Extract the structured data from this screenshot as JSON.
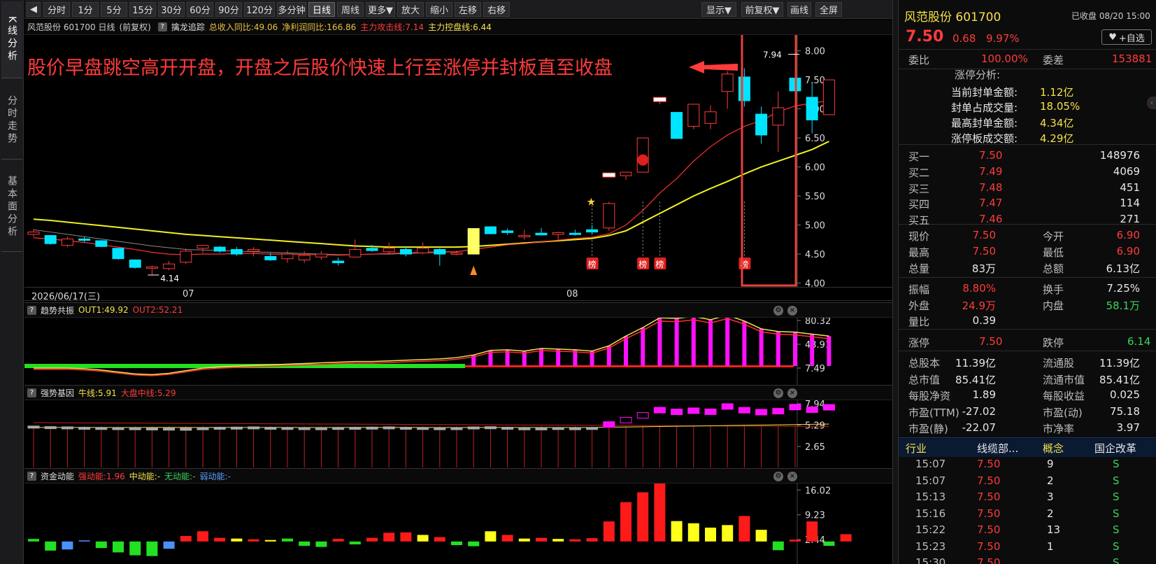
{
  "sidebar": {
    "tabs": [
      {
        "label": "K线分析",
        "active": true
      },
      {
        "label": "分时走势",
        "active": false
      },
      {
        "label": "基本面分析",
        "active": false
      }
    ]
  },
  "toolbar": {
    "back_icon": "collapse-left-icon",
    "buttons": [
      "分时",
      "1分",
      "5分",
      "15分",
      "30分",
      "60分",
      "90分",
      "120分",
      "多分钟",
      "日线",
      "周线",
      "更多▼",
      "放大",
      "缩小",
      "左移",
      "右移"
    ],
    "active": "日线",
    "right_buttons": [
      "显示▼",
      "前复权▼",
      "画线",
      "全屏"
    ]
  },
  "kline": {
    "info": {
      "title": "风范股份 601700 日线",
      "adjust": "(前复权)",
      "help": "?",
      "indicator": "擒龙追踪",
      "f1": "总收入同比:49.06",
      "f2": "净利润同比:166.86",
      "f3": "主力攻击线:7.14",
      "f4": "主力控盘线:6.44"
    },
    "annotation": "股价早盘跳空高开开盘，开盘之后股价快速上行至涨停并封板直至收盘",
    "y_ticks": [
      "8.00",
      "7.50",
      "7.00",
      "6.50",
      "6.00",
      "5.50",
      "5.00",
      "4.50",
      "4.00"
    ],
    "date_label": "2026/06/17(三)",
    "month_labels": [
      "07",
      "08"
    ],
    "high_label": "7.94",
    "low_label": "4.14",
    "bang_label": "榜",
    "colors": {
      "up": "#ff3b3b",
      "down": "#00e5ff",
      "ma_attack": "#ff3030",
      "ma_control": "#f0f020",
      "ma_gray": "#8a8a8a"
    },
    "candles": [
      [
        4.84,
        4.93,
        4.8,
        4.88
      ],
      [
        4.82,
        4.83,
        4.66,
        4.68
      ],
      [
        4.65,
        4.8,
        4.62,
        4.76
      ],
      [
        4.76,
        4.8,
        4.7,
        4.74
      ],
      [
        4.73,
        4.74,
        4.62,
        4.63
      ],
      [
        4.6,
        4.61,
        4.4,
        4.42
      ],
      [
        4.4,
        4.41,
        4.25,
        4.27
      ],
      [
        4.26,
        4.3,
        4.14,
        4.28
      ],
      [
        4.25,
        4.38,
        4.22,
        4.33
      ],
      [
        4.36,
        4.6,
        4.33,
        4.55
      ],
      [
        4.6,
        4.66,
        4.52,
        4.65
      ],
      [
        4.62,
        4.64,
        4.52,
        4.55
      ],
      [
        4.58,
        4.62,
        4.47,
        4.5
      ],
      [
        4.55,
        4.62,
        4.46,
        4.58
      ],
      [
        4.46,
        4.52,
        4.38,
        4.4
      ],
      [
        4.42,
        4.56,
        4.35,
        4.5
      ],
      [
        4.4,
        4.55,
        4.35,
        4.48
      ],
      [
        4.45,
        4.55,
        4.4,
        4.5
      ],
      [
        4.38,
        4.44,
        4.3,
        4.35
      ],
      [
        4.45,
        4.75,
        4.44,
        4.58
      ],
      [
        4.6,
        4.66,
        4.54,
        4.56
      ],
      [
        4.54,
        4.7,
        4.5,
        4.6
      ],
      [
        4.58,
        4.64,
        4.46,
        4.5
      ],
      [
        4.52,
        4.7,
        4.5,
        4.6
      ],
      [
        4.58,
        4.6,
        4.3,
        4.5
      ],
      [
        4.5,
        4.56,
        4.48,
        4.52
      ],
      [
        4.5,
        4.94,
        4.5,
        4.94
      ],
      [
        4.97,
        4.98,
        4.84,
        4.85
      ],
      [
        4.9,
        4.94,
        4.83,
        4.87
      ],
      [
        4.8,
        4.92,
        4.75,
        4.82
      ],
      [
        4.86,
        4.95,
        4.82,
        4.83
      ],
      [
        4.84,
        4.89,
        4.75,
        4.87
      ],
      [
        4.86,
        4.92,
        4.82,
        4.85
      ],
      [
        4.92,
        5.0,
        4.84,
        4.88
      ],
      [
        4.95,
        5.4,
        4.9,
        5.37
      ],
      [
        5.85,
        5.91,
        5.78,
        5.91
      ],
      [
        5.91,
        6.5,
        5.91,
        6.5
      ],
      [
        7.15,
        7.16,
        7.08,
        7.15
      ],
      [
        6.94,
        6.94,
        6.54,
        6.49
      ],
      [
        6.7,
        7.08,
        6.65,
        7.08
      ],
      [
        6.75,
        7.06,
        6.65,
        6.95
      ],
      [
        7.3,
        7.65,
        7.0,
        7.6
      ],
      [
        7.55,
        7.7,
        7.04,
        7.14
      ],
      [
        6.91,
        7.04,
        6.4,
        6.55
      ],
      [
        6.72,
        7.3,
        6.26,
        7.02
      ],
      [
        7.53,
        7.94,
        7.25,
        7.31
      ],
      [
        7.2,
        7.44,
        6.58,
        6.81
      ],
      [
        6.9,
        7.5,
        6.9,
        7.5
      ]
    ],
    "ma_attack": [
      4.78,
      4.76,
      4.73,
      4.7,
      4.66,
      4.62,
      4.58,
      4.53,
      4.5,
      4.49,
      4.5,
      4.5,
      4.51,
      4.51,
      4.5,
      4.5,
      4.49,
      4.49,
      4.48,
      4.49,
      4.5,
      4.51,
      4.52,
      4.53,
      4.54,
      4.54,
      4.58,
      4.62,
      4.66,
      4.68,
      4.71,
      4.74,
      4.77,
      4.79,
      4.85,
      5.0,
      5.25,
      5.55,
      5.8,
      6.1,
      6.35,
      6.55,
      6.7,
      6.8,
      6.95,
      7.05,
      7.1,
      7.14
    ],
    "ma_control": [
      5.1,
      5.08,
      5.05,
      5.02,
      4.99,
      4.96,
      4.93,
      4.9,
      4.87,
      4.84,
      4.82,
      4.8,
      4.78,
      4.76,
      4.74,
      4.72,
      4.7,
      4.68,
      4.66,
      4.64,
      4.63,
      4.62,
      4.62,
      4.62,
      4.62,
      4.62,
      4.63,
      4.65,
      4.67,
      4.69,
      4.71,
      4.73,
      4.75,
      4.77,
      4.82,
      4.9,
      5.05,
      5.2,
      5.35,
      5.5,
      5.63,
      5.75,
      5.88,
      6.0,
      6.1,
      6.2,
      6.3,
      6.44
    ],
    "ma_gray": [
      4.92,
      4.88,
      4.84,
      4.8,
      4.76,
      4.72,
      4.68,
      4.64,
      4.61,
      4.58,
      4.57,
      4.56,
      4.55,
      4.54,
      4.53,
      4.52,
      4.51,
      4.5,
      4.49,
      4.49,
      4.5,
      4.5,
      4.51,
      4.52,
      4.53,
      4.54,
      4.58,
      4.62,
      4.66,
      4.7
    ]
  },
  "trend": {
    "help": "?",
    "name": "趋势共振",
    "out1": "OUT1:49.92",
    "out2": "OUT2:52.21",
    "y_ticks": [
      "80.32",
      "43.91",
      "7.49"
    ],
    "values": [
      0,
      0,
      0,
      -1,
      -3,
      -6,
      -9,
      -10,
      -8,
      -4,
      0,
      2,
      3,
      4,
      5,
      6,
      7,
      8,
      9,
      10,
      10,
      11,
      12,
      13,
      14,
      16,
      20,
      27,
      28,
      26,
      30,
      29,
      28,
      26,
      34,
      49,
      62,
      77,
      76,
      79,
      74,
      81,
      72,
      60,
      56,
      55,
      52,
      49
    ],
    "bars_from": 26
  },
  "gene": {
    "help": "?",
    "name": "强势基因",
    "niu": "牛线:5.91",
    "dapan": "大盘中线:5.29",
    "y_ticks": [
      "7.94",
      "5.29",
      "2.65"
    ],
    "marks": [
      5.05,
      4.98,
      4.95,
      4.9,
      4.88,
      4.86,
      4.85,
      4.82,
      4.8,
      4.78,
      4.85,
      4.9,
      4.92,
      4.95,
      4.9,
      4.88,
      4.86,
      4.85,
      4.88,
      4.9,
      4.92,
      4.95,
      4.9,
      4.88,
      4.85,
      4.86,
      4.94,
      4.97,
      4.9,
      4.84,
      4.83,
      4.87,
      4.85,
      4.88,
      5.37,
      5.91,
      6.5,
      7.15,
      6.94,
      7.08,
      6.95,
      7.6,
      7.14,
      6.9,
      7.02,
      7.53,
      7.2,
      7.5
    ]
  },
  "money": {
    "help": "?",
    "name": "资金动能",
    "strong": "强动能:1.96",
    "mid": "中动能:-",
    "none": "无动能:-",
    "weak": "弱动能:-",
    "y_ticks": [
      "16.02",
      "9.23",
      "2.44"
    ],
    "bars": [
      [
        0.7,
        "g"
      ],
      [
        -2.5,
        "g"
      ],
      [
        -2.2,
        "b"
      ],
      [
        0.3,
        "b"
      ],
      [
        -1.8,
        "g"
      ],
      [
        -3.0,
        "g"
      ],
      [
        -3.8,
        "g"
      ],
      [
        -4.0,
        "g"
      ],
      [
        -2.0,
        "b"
      ],
      [
        1.5,
        "r"
      ],
      [
        2.8,
        "r"
      ],
      [
        1.0,
        "r"
      ],
      [
        0.8,
        "y"
      ],
      [
        0.6,
        "r"
      ],
      [
        0.4,
        "y"
      ],
      [
        0.8,
        "g"
      ],
      [
        -1.2,
        "g"
      ],
      [
        -1.5,
        "g"
      ],
      [
        0.7,
        "r"
      ],
      [
        -0.8,
        "g"
      ],
      [
        1.0,
        "r"
      ],
      [
        2.4,
        "r"
      ],
      [
        2.5,
        "r"
      ],
      [
        1.8,
        "y"
      ],
      [
        1.2,
        "r"
      ],
      [
        -1.0,
        "g"
      ],
      [
        -1.3,
        "g"
      ],
      [
        2.8,
        "y"
      ],
      [
        1.8,
        "r"
      ],
      [
        0.8,
        "y"
      ],
      [
        1.0,
        "r"
      ],
      [
        0.7,
        "y"
      ],
      [
        0.6,
        "r"
      ],
      [
        0.9,
        "r"
      ],
      [
        5.5,
        "r"
      ],
      [
        10.8,
        "r"
      ],
      [
        13.5,
        "r"
      ],
      [
        16.3,
        "r"
      ],
      [
        5.6,
        "y"
      ],
      [
        5.0,
        "y"
      ],
      [
        3.8,
        "y"
      ],
      [
        4.5,
        "y"
      ],
      [
        7.0,
        "r"
      ],
      [
        3.2,
        "y"
      ],
      [
        -2.4,
        "g"
      ],
      [
        0.5,
        "r"
      ],
      [
        5.5,
        "r"
      ],
      [
        -1.2,
        "g"
      ],
      [
        2.0,
        "r"
      ]
    ]
  },
  "stock": {
    "name": "风范股份",
    "code": "601700",
    "status": "已收盘 08/20 15:00",
    "price": "7.50",
    "change": "0.68",
    "pct": "9.97%",
    "add_label": "+自选",
    "weibi_label": "委比",
    "weibi": "100.00%",
    "weicha_label": "委差",
    "weicha": "153881",
    "zt_title": "涨停分析:",
    "zt": [
      {
        "k": "当前封单金额:",
        "v": "1.12亿"
      },
      {
        "k": "封单占成交量:",
        "v": "18.05%"
      },
      {
        "k": "最高封单金额:",
        "v": "4.34亿"
      },
      {
        "k": "涨停板成交额:",
        "v": "4.29亿"
      }
    ],
    "bids": [
      {
        "k": "买一",
        "p": "7.50",
        "v": "148976"
      },
      {
        "k": "买二",
        "p": "7.49",
        "v": "4069"
      },
      {
        "k": "买三",
        "p": "7.48",
        "v": "451"
      },
      {
        "k": "买四",
        "p": "7.47",
        "v": "114"
      },
      {
        "k": "买五",
        "p": "7.46",
        "v": "271"
      }
    ],
    "q1": [
      [
        "现价",
        "7.50",
        "今开",
        "6.90"
      ],
      [
        "最高",
        "7.50",
        "最低",
        "6.90"
      ],
      [
        "总量",
        "83万",
        "总额",
        "6.13亿"
      ]
    ],
    "q2": [
      [
        "振幅",
        "8.80%",
        "换手",
        "7.25%"
      ],
      [
        "外盘",
        "24.9万",
        "内盘",
        "58.1万"
      ],
      [
        "量比",
        "0.39",
        "",
        ""
      ]
    ],
    "limit": [
      "涨停",
      "7.50",
      "跌停",
      "6.14"
    ],
    "q3": [
      [
        "总股本",
        "11.39亿",
        "流通股",
        "11.39亿"
      ],
      [
        "总市值",
        "85.41亿",
        "流通市值",
        "85.41亿"
      ],
      [
        "每股净资",
        "1.89",
        "每股收益",
        "0.025"
      ],
      [
        "市盈(TTM)",
        "-27.02",
        "市盈(动)",
        "75.18"
      ],
      [
        "市盈(静)",
        "-22.07",
        "市净率",
        "3.97"
      ]
    ],
    "tags": [
      "行业",
      "线缆部...",
      "概念",
      "国企改革"
    ],
    "ticks": [
      [
        "15:07",
        "7.50",
        "9",
        "S"
      ],
      [
        "15:07",
        "7.50",
        "2",
        "S"
      ],
      [
        "15:13",
        "7.50",
        "3",
        "S"
      ],
      [
        "15:16",
        "7.50",
        "2",
        "S"
      ],
      [
        "15:22",
        "7.50",
        "13",
        "S"
      ],
      [
        "15:23",
        "7.50",
        "1",
        "S"
      ],
      [
        "15:30",
        "7.50",
        "",
        "S"
      ]
    ]
  }
}
